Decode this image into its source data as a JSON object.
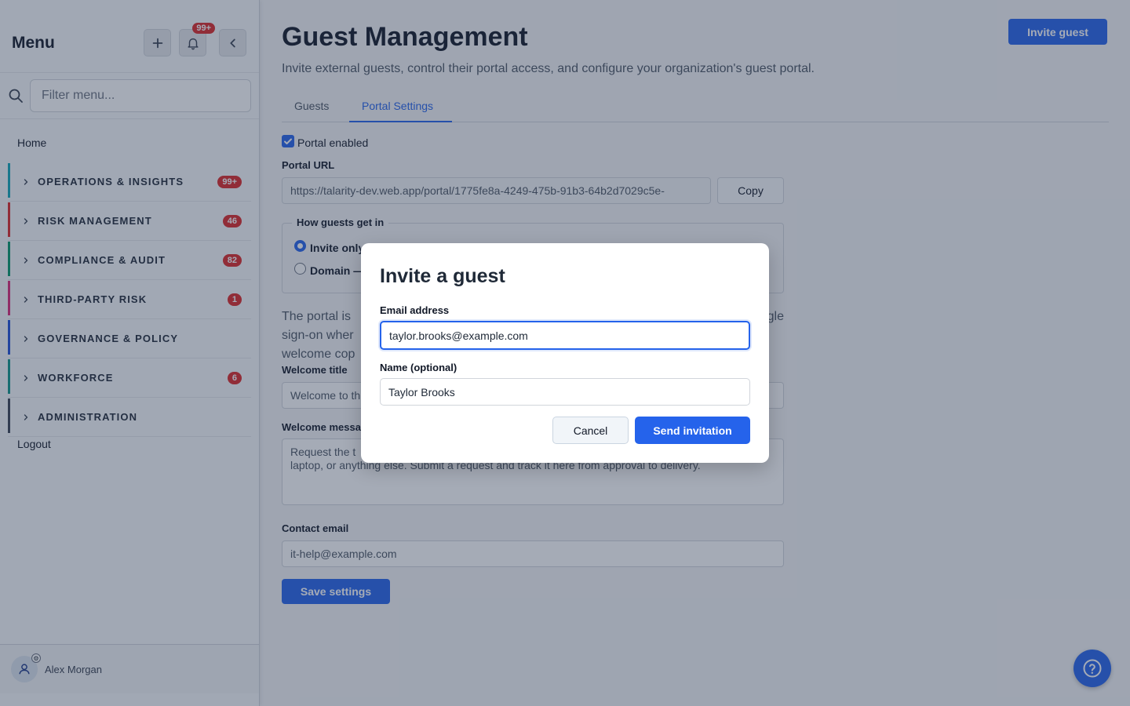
{
  "sidebar": {
    "title": "Menu",
    "notifications_badge": "99+",
    "filter_placeholder": "Filter menu...",
    "home_label": "Home",
    "groups": [
      {
        "label": "OPERATIONS & INSIGHTS",
        "badge": "99+",
        "color": "#0ea5b7"
      },
      {
        "label": "RISK MANAGEMENT",
        "badge": "46",
        "color": "#dc2626"
      },
      {
        "label": "COMPLIANCE & AUDIT",
        "badge": "82",
        "color": "#059669"
      },
      {
        "label": "THIRD-PARTY RISK",
        "badge": "1",
        "color": "#db2777"
      },
      {
        "label": "GOVERNANCE & POLICY",
        "badge": "",
        "color": "#1d4ed8"
      },
      {
        "label": "WORKFORCE",
        "badge": "6",
        "color": "#0d9488"
      },
      {
        "label": "ADMINISTRATION",
        "badge": "",
        "color": "#374151"
      }
    ],
    "logout_label": "Logout",
    "user_name": "Alex Morgan"
  },
  "main": {
    "title": "Guest Management",
    "invite_button": "Invite guest",
    "subtitle": "Invite external guests, control their portal access, and configure your organization's guest portal.",
    "tabs": [
      {
        "label": "Guests",
        "active": false
      },
      {
        "label": "Portal Settings",
        "active": true
      }
    ],
    "portal_enabled_label": "Portal enabled",
    "portal_enabled": true,
    "portal_url_label": "Portal URL",
    "portal_url_value": "https://talarity-dev.web.app/portal/1775fe8a-4249-475b-91b3-64b2d7029c5e-",
    "copy_button": "Copy",
    "access_legend": "How guests get in",
    "access_options": [
      {
        "label": "Invite only",
        "selected": true
      },
      {
        "label": "Domain —",
        "selected": false
      }
    ],
    "description_line1": "The portal is",
    "description_line1_end": "gle",
    "description_line2": "sign-on wher",
    "description_line3": "welcome cop",
    "welcome_title_label": "Welcome title",
    "welcome_title_value": "Welcome to th",
    "welcome_message_label": "Welcome messa",
    "welcome_message_line1": "Request the t",
    "welcome_message_line2": "laptop, or anything else. Submit a request and track it here from approval to delivery.",
    "contact_email_label": "Contact email",
    "contact_email_value": "it-help@example.com",
    "save_button": "Save settings"
  },
  "modal": {
    "title": "Invite a guest",
    "email_label": "Email address",
    "email_value": "taylor.brooks@example.com",
    "name_label": "Name (optional)",
    "name_value": "Taylor Brooks",
    "cancel_button": "Cancel",
    "send_button": "Send invitation"
  },
  "colors": {
    "accent": "#2563eb",
    "badge": "#dc2626"
  }
}
